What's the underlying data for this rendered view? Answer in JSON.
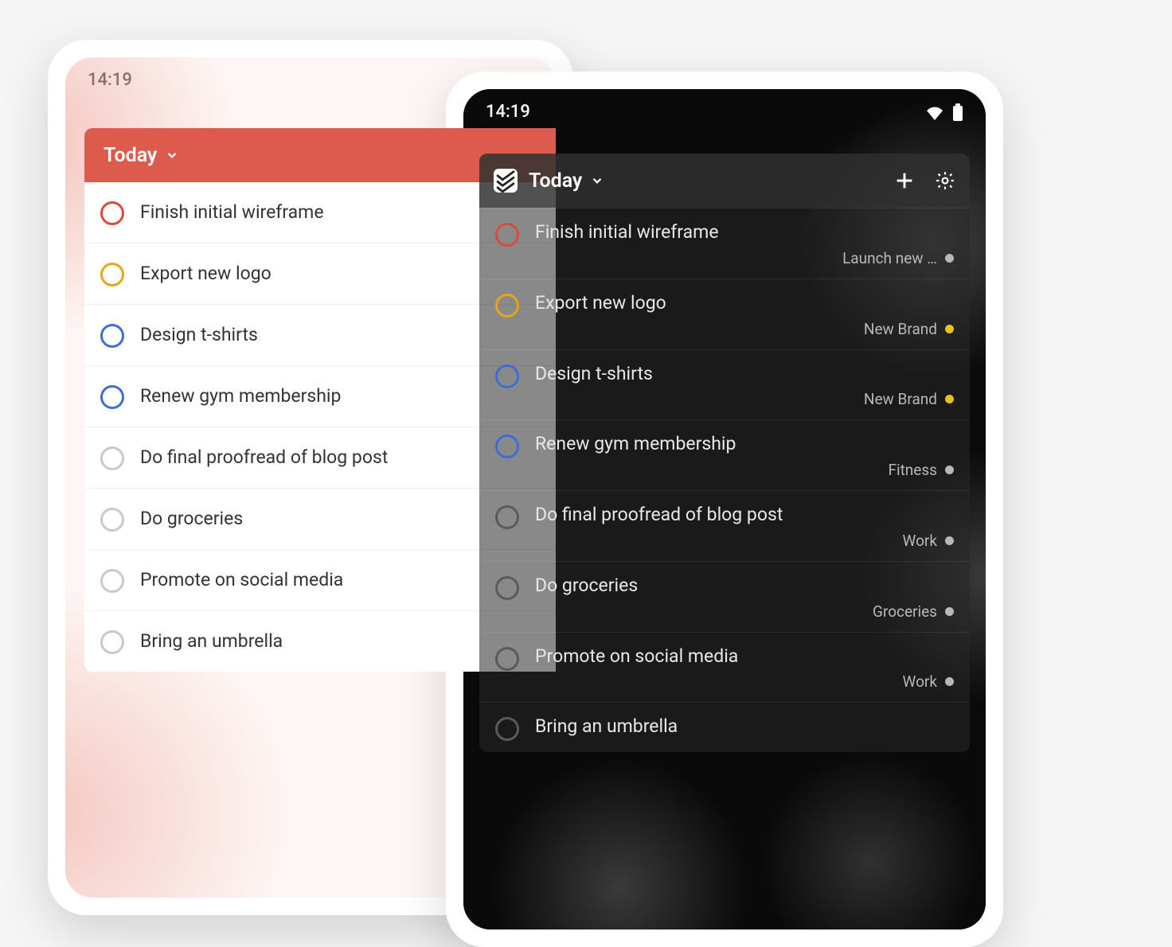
{
  "status": {
    "time": "14:19"
  },
  "colors": {
    "red": "#d94b3a",
    "orange": "#e6a417",
    "blue": "#3b6fd6",
    "grey_light": "#c9c9c9",
    "grey_dark": "#5a5a5a",
    "tag_grey": "#b8b8b8",
    "tag_yellow": "#e6c417"
  },
  "light": {
    "header": "Today",
    "tasks": [
      {
        "title": "Finish initial wireframe",
        "ring": "red"
      },
      {
        "title": "Export new logo",
        "ring": "orange"
      },
      {
        "title": "Design t-shirts",
        "ring": "blue"
      },
      {
        "title": "Renew gym membership",
        "ring": "blue"
      },
      {
        "title": "Do final proofread of blog post",
        "ring": "grey_light"
      },
      {
        "title": "Do groceries",
        "ring": "grey_light"
      },
      {
        "title": "Promote on social media",
        "ring": "grey_light"
      },
      {
        "title": "Bring an umbrella",
        "ring": "grey_light"
      }
    ]
  },
  "dark": {
    "header": "Today",
    "tasks": [
      {
        "title": "Finish initial wireframe",
        "ring": "red",
        "project": "Launch new …",
        "dot": "tag_grey"
      },
      {
        "title": "Export new logo",
        "ring": "orange",
        "project": "New Brand",
        "dot": "tag_yellow"
      },
      {
        "title": "Design t-shirts",
        "ring": "blue",
        "project": "New Brand",
        "dot": "tag_yellow"
      },
      {
        "title": "Renew gym membership",
        "ring": "blue",
        "project": "Fitness",
        "dot": "tag_grey"
      },
      {
        "title": "Do final proofread of blog post",
        "ring": "grey_dark",
        "project": "Work",
        "dot": "tag_grey"
      },
      {
        "title": "Do groceries",
        "ring": "grey_dark",
        "project": "Groceries",
        "dot": "tag_grey"
      },
      {
        "title": "Promote on social media",
        "ring": "grey_dark",
        "project": "Work",
        "dot": "tag_grey"
      },
      {
        "title": "Bring an umbrella",
        "ring": "grey_dark"
      }
    ]
  }
}
